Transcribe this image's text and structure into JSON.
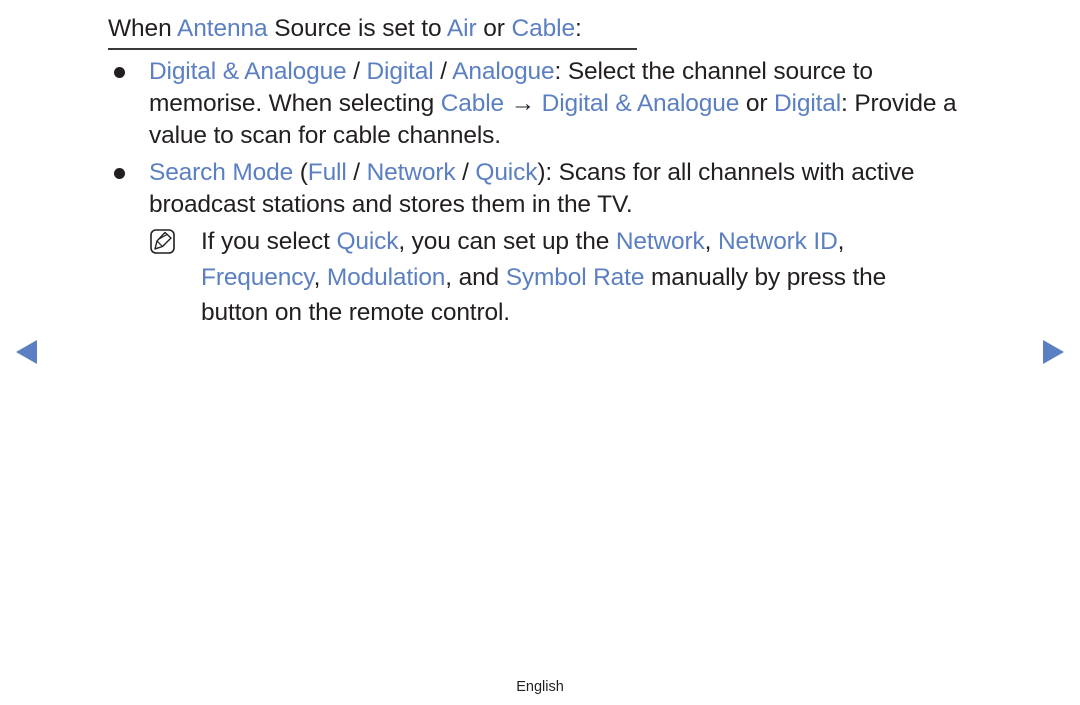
{
  "heading": {
    "parts": [
      "When ",
      "Antenna",
      " Source is set to ",
      "Air",
      " or ",
      "Cable",
      ":"
    ]
  },
  "bullets": [
    {
      "lines": [
        [
          "Digital & Analogue",
          " / ",
          "Digital",
          " / ",
          "Analogue",
          ": Select the channel source to"
        ],
        [
          "memorise. When selecting ",
          "Cable",
          " → ",
          "Digital & Analogue",
          " or ",
          "Digital",
          ": Provide a"
        ],
        [
          "value to scan for cable channels."
        ]
      ]
    },
    {
      "lines": [
        [
          "Search Mode",
          " (",
          "Full",
          " / ",
          "Network",
          " / ",
          "Quick",
          "): Scans for all channels with active"
        ],
        [
          "broadcast stations and stores them in the TV."
        ]
      ]
    }
  ],
  "note": {
    "icon": "note-pencil-icon",
    "lines": [
      [
        "If you select ",
        "Quick",
        ", you can set up the ",
        "Network",
        ", ",
        "Network ID",
        ","
      ],
      [
        "Frequency",
        ", ",
        "Modulation",
        ", and ",
        "Symbol Rate",
        " manually by press the"
      ],
      [
        "button on the remote control."
      ]
    ]
  },
  "navigation": {
    "prev_icon": "triangle-left-icon",
    "next_icon": "triangle-right-icon",
    "color": "#5b7fc3"
  },
  "footer": {
    "language": "English"
  },
  "colors": {
    "highlight": "#5b7fc3",
    "text": "#231f20"
  }
}
